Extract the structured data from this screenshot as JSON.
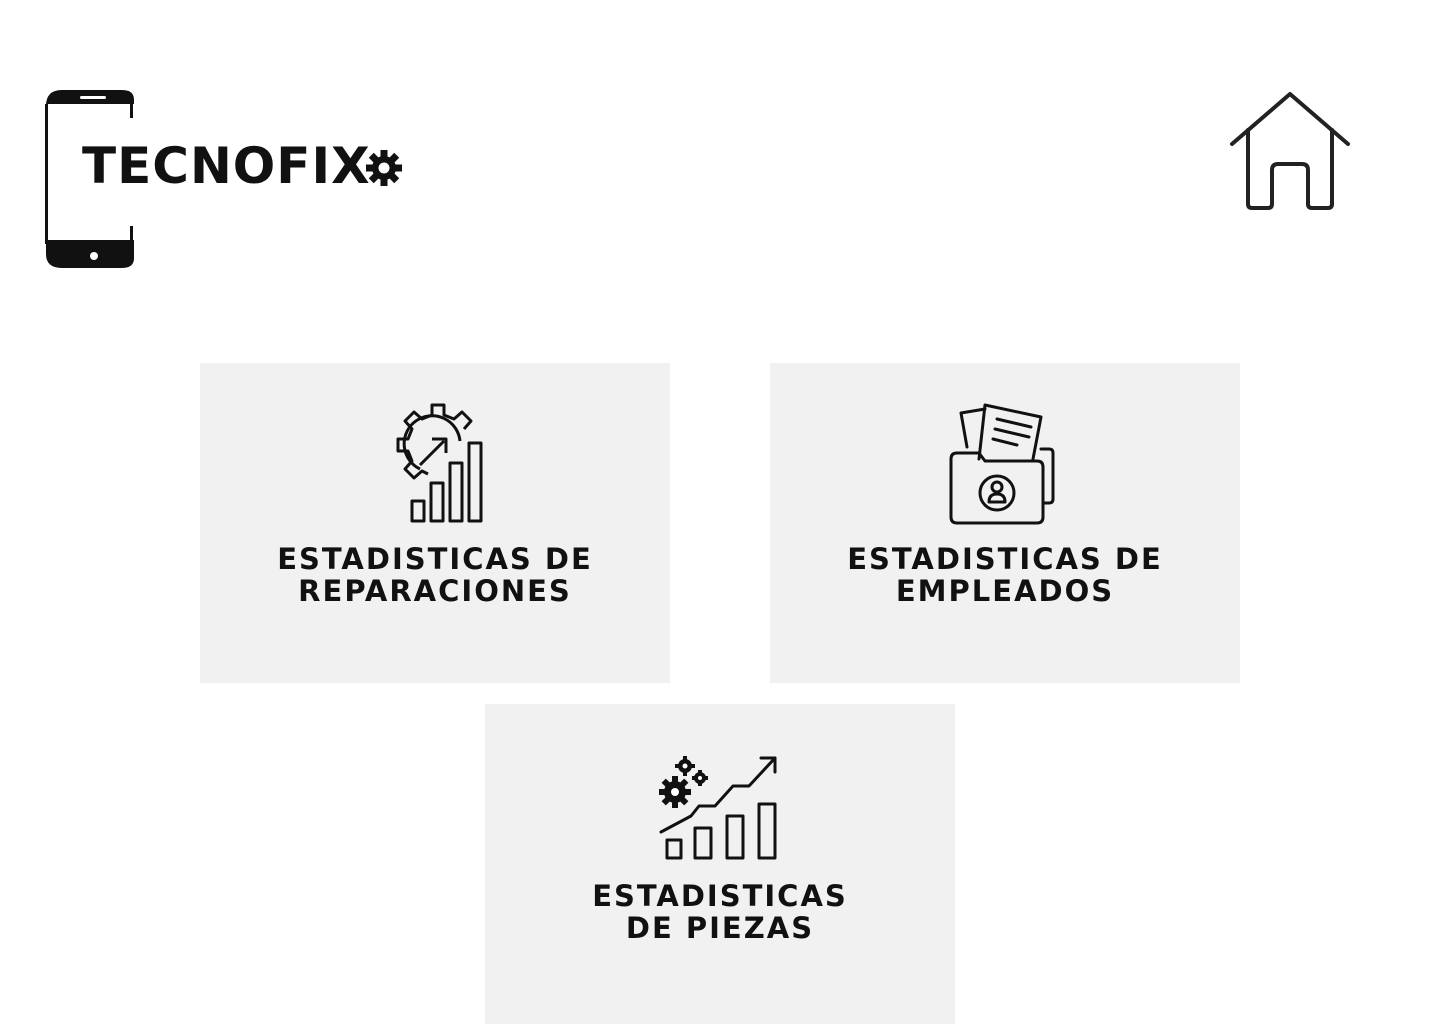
{
  "header": {
    "logo": {
      "text": "TECNOFIX",
      "icon": "smartphone-icon",
      "gear_icon": "gear-icon"
    },
    "home": {
      "icon": "home-icon"
    }
  },
  "cards": [
    {
      "icon": "gear-chart-icon",
      "line1": "ESTADISTICAS DE",
      "line2": "REPARACIONES"
    },
    {
      "icon": "employee-folder-icon",
      "line1": "ESTADISTICAS DE",
      "line2": "EMPLEADOS"
    },
    {
      "icon": "gears-growth-chart-icon",
      "line1": "ESTADISTICAS",
      "line2": "DE PIEZAS"
    }
  ],
  "colors": {
    "background": "#ffffff",
    "card": "#f1f1f1",
    "ink": "#111111"
  }
}
